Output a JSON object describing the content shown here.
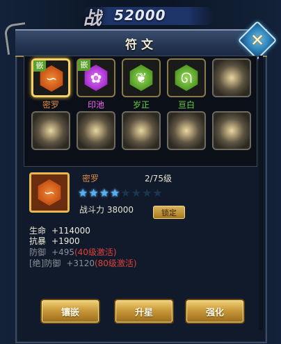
{
  "header": {
    "power_label": "战",
    "power_value": "52000"
  },
  "panel": {
    "title": "符文",
    "close_icon": "close-icon"
  },
  "slots": [
    {
      "name": "密罗",
      "color": "#e08a3c",
      "inlay": "嵌",
      "icon": "orange-rune-icon",
      "selected": true
    },
    {
      "name": "印池",
      "color": "#ff66ff",
      "inlay": "嵌",
      "icon": "purple-rune-icon",
      "selected": false
    },
    {
      "name": "岁正",
      "color": "#6cd44a",
      "inlay": "",
      "icon": "green-rune-icon",
      "selected": false
    },
    {
      "name": "亘白",
      "color": "#6cd44a",
      "inlay": "",
      "icon": "green-rune-icon",
      "selected": false
    }
  ],
  "detail": {
    "name": "密罗",
    "level": "2/75级",
    "stars_filled": 4,
    "stars_total": 8,
    "power_text": "战斗力 38000",
    "lock_label": "锁定"
  },
  "stats": [
    {
      "label": "生命",
      "value": "+114000",
      "suffix": ""
    },
    {
      "label": "抗暴",
      "value": "+1900",
      "suffix": ""
    },
    {
      "label": "防御",
      "value": "+495",
      "suffix": "(40级激活)"
    },
    {
      "label": "[绝]防御",
      "value": "+3120",
      "suffix": "(80级激活)"
    }
  ],
  "actions": {
    "inlay": "镶嵌",
    "upgrade": "升星",
    "enhance": "强化"
  }
}
